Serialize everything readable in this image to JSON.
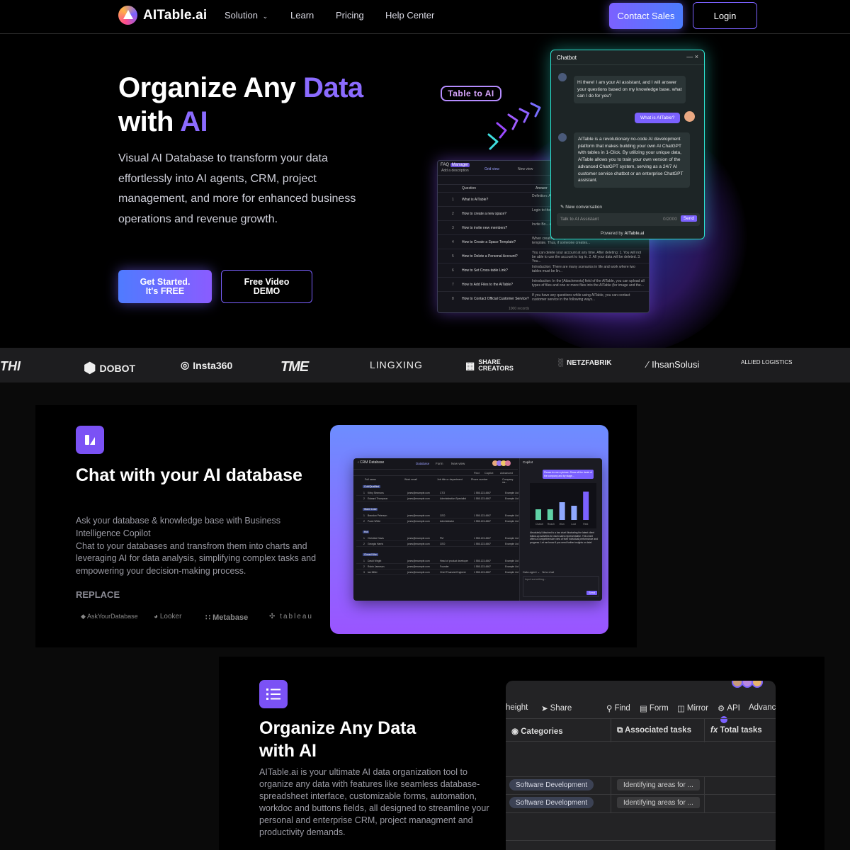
{
  "nav": {
    "logo": "AITable.ai",
    "links": [
      "Solution",
      "Learn",
      "Pricing",
      "Help Center"
    ],
    "contact": "Contact Sales",
    "login": "Login"
  },
  "hero": {
    "title_1": "Organize Any ",
    "title_1_accent": "Data",
    "title_2": "with ",
    "title_2_accent": "AI",
    "description": "Visual AI Database to transform your data effortlessly into AI agents, CRM, project management, and more for enhanced business operations and revenue growth.",
    "cta_primary_1": "Get Started.",
    "cta_primary_2": "It's FREE",
    "cta_secondary_1": "Free Video",
    "cta_secondary_2": "DEMO",
    "badge": "Table to AI"
  },
  "faq_panel": {
    "title": "FAQ",
    "tag": "Manager",
    "subtitle": "Add a description",
    "grid_view": "Grid view",
    "new_view": "New view",
    "col_question": "Question",
    "col_answer": "Answer",
    "rows": [
      {
        "n": "1",
        "q": "What is AITable?",
        "a": "Definition: AITable is..."
      },
      {
        "n": "2",
        "q": "How to create a new space?",
        "a": "Login to the AITable, click below the..."
      },
      {
        "n": "3",
        "q": "How to invite new members?",
        "a": "Invite Bo... Admin..."
      },
      {
        "n": "4",
        "q": "How to Create a Space Template?",
        "a": "When creating a template... there should be a place to store the template. Thus, if someone creates..."
      },
      {
        "n": "5",
        "q": "How to Delete a Personal Account?",
        "a": "You can delete your account at any time. After deleting: 1. You will not be able to use the account to log in. 2. All your data will be deleted. 3. You..."
      },
      {
        "n": "6",
        "q": "How to Set Cross-table Link?",
        "a": "Introduction: There are many scenarios in life and work where two tables must be lin..."
      },
      {
        "n": "7",
        "q": "How to Add Files to the AITable?",
        "a": "Introduction: In the [Attachments] field of the AITable, you can upload all types of files and one or more files into the AITable (for image and the..."
      },
      {
        "n": "8",
        "q": "How to Contact Official Customer Service?",
        "a": "If you have any questions while using AITable, you can contact customer service in the following ways..."
      }
    ],
    "footer": "1000 records"
  },
  "chatbot": {
    "title": "Chatbot",
    "greeting": "Hi there! I am your AI assistant, and I will answer your questions based on my knowledge base. what can I do for you?",
    "user_question": "What is AITable?",
    "answer": "AITable is a revolutionary no-code AI development platform that makes building your own AI ChatGPT with tables in 1-Click. By utilizing your unique data, AITable allows you to train your own version of the advanced ChatGPT system, serving as a 24/7 AI customer service chatbot or an enterprise ChatGPT assistant.",
    "new_conversation": "New conversation",
    "input_placeholder": "Talk to AI Assistant",
    "counter": "0/2000",
    "send": "Send",
    "powered_by": "Powered by",
    "powered_brand": "AITable.ai"
  },
  "logos": [
    "THI",
    "DOBOT",
    "Insta360",
    "TME",
    "LINGXING",
    "SHARE CREATORS",
    "NETZFABRIK",
    "IhsanSolusi",
    "ALLIED LOGISTICS"
  ],
  "feature1": {
    "title": "Chat with your AI database",
    "desc_1": "Ask your database & knowledge base with Business Intelligence Copilot",
    "desc_2": "Chat to your databases and transfrom them into charts and leveraging AI for data analysis, simplifying complex tasks and empowering your decision-making process.",
    "replace_label": "REPLACE",
    "replaces": [
      "AskYourDatabase",
      "Looker",
      "Metabase",
      "tableau"
    ]
  },
  "crm_app": {
    "title": "CRM Database",
    "tabs": [
      "Database",
      "Form",
      "New view"
    ],
    "copilot_title": "Copilot",
    "copilot_question": "Please do me a picture: Show all the deals of the company and by stage...",
    "copilot_answer": "Absolutely! Attached is a bar chart illustrating the latest client follow-up activities for each sales representative. This chart offers a comprehensive view of their individual performance and progress. Let me know if you need further insights or data!",
    "chart_categories": [
      "Chanel",
      "Reach",
      "Won",
      "Lost",
      "Rest"
    ],
    "chart_values": [
      3,
      3,
      5,
      4,
      8
    ],
    "groups": [
      {
        "label": "Cold/Qualified",
        "rows": [
          [
            "1",
            "Kirby Simmons",
            "jones@example.com",
            "CTO",
            "1 555-123-4567",
            "Example Ltd"
          ],
          [
            "2",
            "Edward Thompson",
            "jones@example.com",
            "Administration Specialist",
            "1 555-123-4567",
            "Example Ltd"
          ]
        ]
      },
      {
        "label": "Warm Lead",
        "rows": [
          [
            "1",
            "Brandon Peterson",
            "jones@example.com",
            "CEO",
            "1 555-123-4567",
            "Example Ltd"
          ],
          [
            "2",
            "Powe White",
            "jones@example.com",
            "Administrator",
            "1 555-123-4567",
            "Example Ltd"
          ]
        ]
      },
      {
        "label": "Hot",
        "rows": [
          [
            "1",
            "Christine Davis",
            "jones@example.com",
            "PM",
            "1 555-123-4567",
            "Example Ltd"
          ],
          [
            "2",
            "Georgia Harris",
            "jones@example.com",
            "CEO",
            "1 555-123-4567",
            "Example Ltd"
          ]
        ]
      },
      {
        "label": "Closed Won",
        "rows": [
          [
            "1",
            "David Wright",
            "jones@example.com",
            "Head of product developer",
            "1 555-123-4567",
            "Example Ltd"
          ],
          [
            "2",
            "Robin Jameson",
            "jones@example.com",
            "Founder",
            "1 555-123-4567",
            "Example Ltd"
          ],
          [
            "3",
            "Ian Miller",
            "jones@example.com",
            "Chief Financial Engineer",
            "1 555-123-4567",
            "Example Ltd"
          ]
        ]
      }
    ],
    "columns": [
      "Full name",
      "Work email",
      "Job title or department",
      "Phone number",
      "Company na..."
    ],
    "toolbar": [
      "Find",
      "Copilot",
      "Advanced"
    ],
    "data_agent": "Data agent",
    "new_chat": "New chat",
    "input_placeholder": "Input something...",
    "send": "Send"
  },
  "feature2": {
    "title_1": "Organize Any Data",
    "title_2": "with AI",
    "desc": "AITable.ai is your ultimate AI data organization tool to organize any data with features like seamless database-spreadsheet interface, customizable forms, automation, workdoc and buttons fields, all designed to streamline your personal and enterprise CRM, project managment and productivity demands."
  },
  "grid_app": {
    "toolbar": [
      "height",
      "Share",
      "Find",
      "Form",
      "Mirror",
      "API",
      "Advanc"
    ],
    "columns": [
      "Categories",
      "Associated tasks",
      "Total tasks"
    ],
    "rows": [
      {
        "category": "Software Development",
        "task": "Identifying areas for ..."
      },
      {
        "category": "Software Development",
        "task": "Identifying areas for ..."
      }
    ]
  },
  "colors": {
    "accent": "#8b6bff",
    "teal": "#2ee3d0",
    "bg": "#000000"
  }
}
